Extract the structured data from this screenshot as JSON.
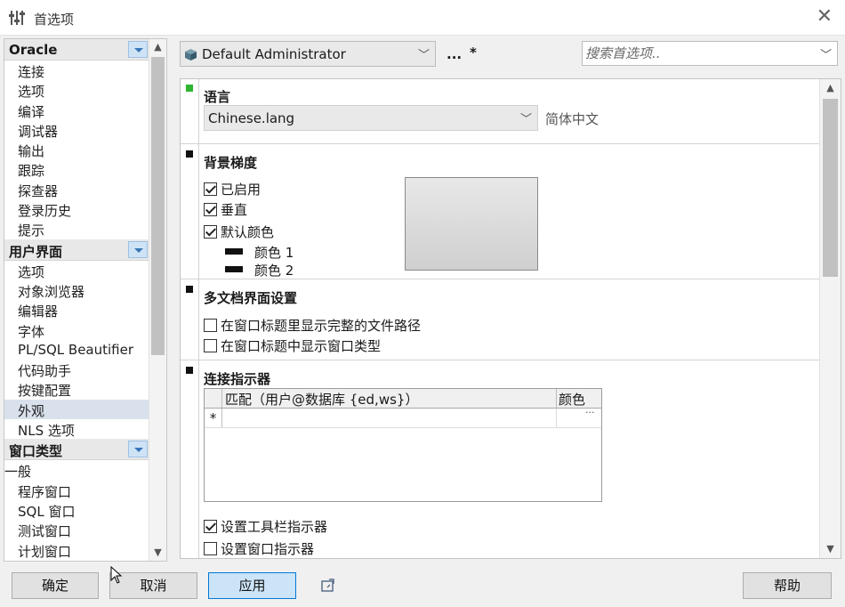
{
  "window": {
    "title": "首选项"
  },
  "nav": {
    "groups": [
      {
        "label": "Oracle",
        "items": [
          "连接",
          "选项",
          "编译",
          "调试器",
          "输出",
          "跟踪",
          "探查器",
          "登录历史",
          "提示"
        ]
      },
      {
        "label": "用户界面",
        "items": [
          "选项",
          "对象浏览器",
          "编辑器",
          "字体",
          "PL/SQL Beautifier",
          "代码助手",
          "按键配置",
          "外观",
          "NLS 选项"
        ],
        "selected": "外观"
      },
      {
        "label": "窗口类型",
        "items": [
          "一般",
          "程序窗口",
          "SQL 窗口",
          "测试窗口",
          "计划窗口"
        ]
      }
    ]
  },
  "toolbar": {
    "profile": "Default Administrator",
    "dots": "...",
    "modified_marker": "*",
    "search_placeholder": "搜索首选项.."
  },
  "sections": {
    "language": {
      "title": "语言",
      "value": "Chinese.lang",
      "hint": "简体中文"
    },
    "background": {
      "title": "背景梯度",
      "enabled_label": "已启用",
      "enabled": true,
      "vertical_label": "垂直",
      "vertical": true,
      "default_color_label": "默认颜色",
      "default_color": true,
      "color1_label": "颜色 1",
      "color2_label": "颜色 2"
    },
    "mdi": {
      "title": "多文档界面设置",
      "full_path_label": "在窗口标题里显示完整的文件路径",
      "full_path": false,
      "window_type_label": "在窗口标题中显示窗口类型",
      "window_type": false
    },
    "connection_indicator": {
      "title": "连接指示器",
      "grid_headers": [
        "匹配（用户@数据库 {ed,ws}）",
        "颜色"
      ],
      "new_row_marker": "*",
      "ellipsis": "···",
      "toolbar_indicator_label": "设置工具栏指示器",
      "toolbar_indicator": true,
      "window_indicator_label": "设置窗口指示器",
      "window_indicator": false
    }
  },
  "buttons": {
    "ok": "确定",
    "cancel": "取消",
    "apply": "应用",
    "help": "帮助"
  }
}
